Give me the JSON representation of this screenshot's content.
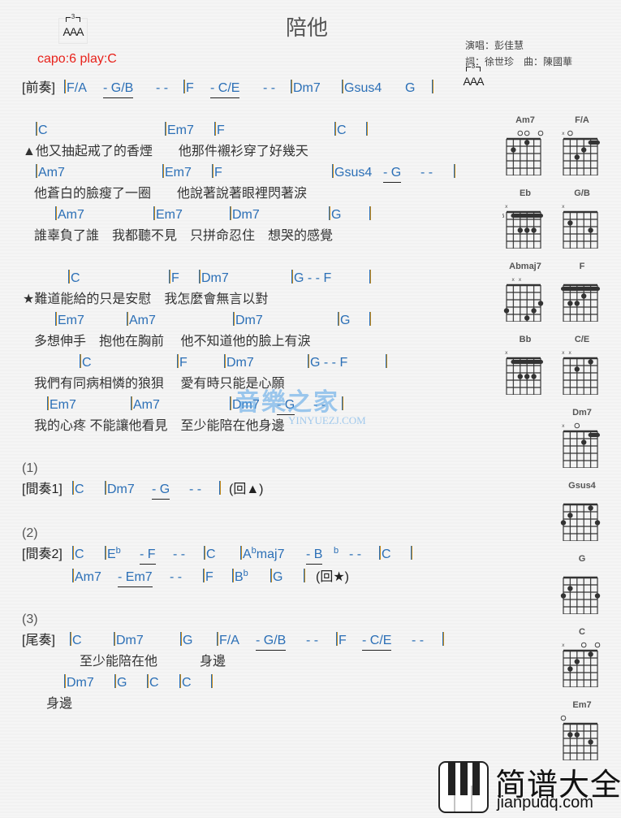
{
  "header": {
    "title": "陪他",
    "capo": "capo:6 play:C",
    "singer": "演唱：彭佳慧",
    "credits": "詞：徐世珍　曲：陳國華",
    "rhythm_marker": {
      "tuplet": "3",
      "letters": "AAA"
    }
  },
  "sections": {
    "prelude": {
      "label": "[前奏]",
      "tokens": [
        "F/A",
        "- G/B",
        "- -",
        "F",
        "- C/E",
        "- -",
        "Dm7",
        "Gsus4",
        "G"
      ]
    },
    "verse": {
      "lines": [
        {
          "chords": [
            "C",
            "Em7",
            "F",
            "C"
          ],
          "lyric": "▲他又抽起戒了的香煙　　他那件襯衫穿了好幾天"
        },
        {
          "chords": [
            "Am7",
            "Em7",
            "F",
            "Gsus4",
            "- G",
            "- -"
          ],
          "lyric": "他蒼白的臉瘦了一圈　　他說著說著眼裡閃著淚"
        },
        {
          "chords": [
            "Am7",
            "Em7",
            "Dm7",
            "G"
          ],
          "lyric": "誰辜負了誰　我都聽不見　只拼命忍住　想哭的感覺"
        }
      ]
    },
    "chorus": {
      "lines": [
        {
          "chords": [
            "C",
            "F",
            "Dm7",
            "G - - F"
          ],
          "lyric": "★難道能給的只是安慰　我怎麼會無言以對"
        },
        {
          "chords": [
            "Em7",
            "Am7",
            "Dm7",
            "G"
          ],
          "lyric": "多想伸手　抱他在胸前　 他不知道他的臉上有淚"
        },
        {
          "chords": [
            "C",
            "F",
            "Dm7",
            "G - - F"
          ],
          "lyric": "我們有同病相憐的狼狽　 愛有時只能是心願"
        },
        {
          "chords": [
            "Em7",
            "Am7",
            "Dm7",
            "- G",
            "- -"
          ],
          "lyric": "我的心疼 不能讓他看見　至少能陪在他身邊"
        }
      ]
    },
    "interlude1": {
      "number": "(1)",
      "label": "[間奏1]",
      "tokens": [
        "C",
        "Dm7",
        "- G",
        "- -"
      ],
      "return": "(回▲)"
    },
    "interlude2": {
      "number": "(2)",
      "label": "[間奏2]",
      "line1": [
        "C",
        "E",
        "b",
        "- F",
        "- -",
        "C",
        "A",
        "b",
        "maj7",
        "- B",
        "b",
        "- -",
        "C"
      ],
      "line2": [
        "Am7",
        "- Em7",
        "- -",
        "F",
        "B",
        "b",
        "G"
      ],
      "return": "(回★)"
    },
    "outro": {
      "number": "(3)",
      "label": "[尾奏]",
      "line1": [
        "C",
        "Dm7",
        "G",
        "F/A",
        "- G/B",
        "- -",
        "F",
        "- C/E",
        "- -"
      ],
      "lyric1a": "至少能陪在他",
      "lyric1b": "身邊",
      "line2": [
        "Dm7",
        "G",
        "C",
        "C"
      ],
      "lyric2": "身邊"
    }
  },
  "chord_diagrams": [
    {
      "name": "Am7",
      "muted": [],
      "open": [
        3,
        4,
        6
      ],
      "barre": null,
      "fret_label": "",
      "dots": [
        [
          4,
          1
        ],
        [
          2,
          2
        ]
      ]
    },
    {
      "name": "F/A",
      "muted": [
        1
      ],
      "open": [
        2
      ],
      "barre": [
        5,
        6,
        1
      ],
      "fret_label": "",
      "dots": [
        [
          4,
          2
        ],
        [
          3,
          3
        ]
      ]
    },
    {
      "name": "Eb",
      "muted": [
        1
      ],
      "open": [],
      "barre": [
        2,
        6,
        1
      ],
      "fret_label": "6",
      "dots": [
        [
          3,
          3
        ],
        [
          4,
          3
        ],
        [
          5,
          3
        ]
      ]
    },
    {
      "name": "G/B",
      "muted": [
        1
      ],
      "open": [],
      "barre": null,
      "fret_label": "",
      "dots": [
        [
          2,
          2
        ],
        [
          5,
          3
        ]
      ]
    },
    {
      "name": "Abmaj7",
      "muted": [
        2,
        3
      ],
      "open": [],
      "barre": null,
      "fret_label": "",
      "dots": [
        [
          6,
          3
        ],
        [
          1,
          4
        ],
        [
          5,
          4
        ],
        [
          4,
          5
        ]
      ]
    },
    {
      "name": "F",
      "muted": [],
      "open": [],
      "barre": [
        1,
        6,
        1
      ],
      "fret_label": "",
      "dots": [
        [
          4,
          2
        ],
        [
          2,
          3
        ],
        [
          3,
          3
        ]
      ]
    },
    {
      "name": "Bb",
      "muted": [
        1
      ],
      "open": [],
      "barre": [
        2,
        6,
        1
      ],
      "fret_label": "",
      "dots": [
        [
          3,
          3
        ],
        [
          4,
          3
        ],
        [
          5,
          3
        ]
      ]
    },
    {
      "name": "C/E",
      "muted": [
        1,
        2
      ],
      "open": [],
      "barre": null,
      "fret_label": "",
      "dots": [
        [
          5,
          1
        ],
        [
          3,
          2
        ]
      ]
    },
    {
      "name": "Dm7",
      "muted": [
        1
      ],
      "open": [
        3
      ],
      "barre": [
        5,
        6,
        1
      ],
      "fret_label": "",
      "dots": [
        [
          4,
          2
        ]
      ]
    },
    {
      "name": "Gsus4",
      "muted": [],
      "open": [],
      "barre": null,
      "fret_label": "",
      "dots": [
        [
          5,
          1
        ],
        [
          2,
          2
        ],
        [
          1,
          3
        ],
        [
          6,
          3
        ]
      ]
    },
    {
      "name": "G",
      "muted": [],
      "open": [],
      "barre": null,
      "fret_label": "",
      "dots": [
        [
          2,
          2
        ],
        [
          1,
          3
        ],
        [
          6,
          3
        ]
      ]
    },
    {
      "name": "C",
      "muted": [
        1
      ],
      "open": [
        4,
        6
      ],
      "barre": null,
      "fret_label": "",
      "dots": [
        [
          5,
          1
        ],
        [
          3,
          2
        ],
        [
          2,
          3
        ]
      ]
    },
    {
      "name": "Em7",
      "muted": [],
      "open": [
        1
      ],
      "barre": null,
      "fret_label": "",
      "dots": [
        [
          2,
          2
        ],
        [
          3,
          2
        ],
        [
          5,
          3
        ]
      ]
    }
  ],
  "watermark": {
    "cn": "音樂之家",
    "en": "YINYUEZJ.COM"
  },
  "logo": {
    "cn": "简谱大全",
    "en": "jianpudq.com"
  }
}
